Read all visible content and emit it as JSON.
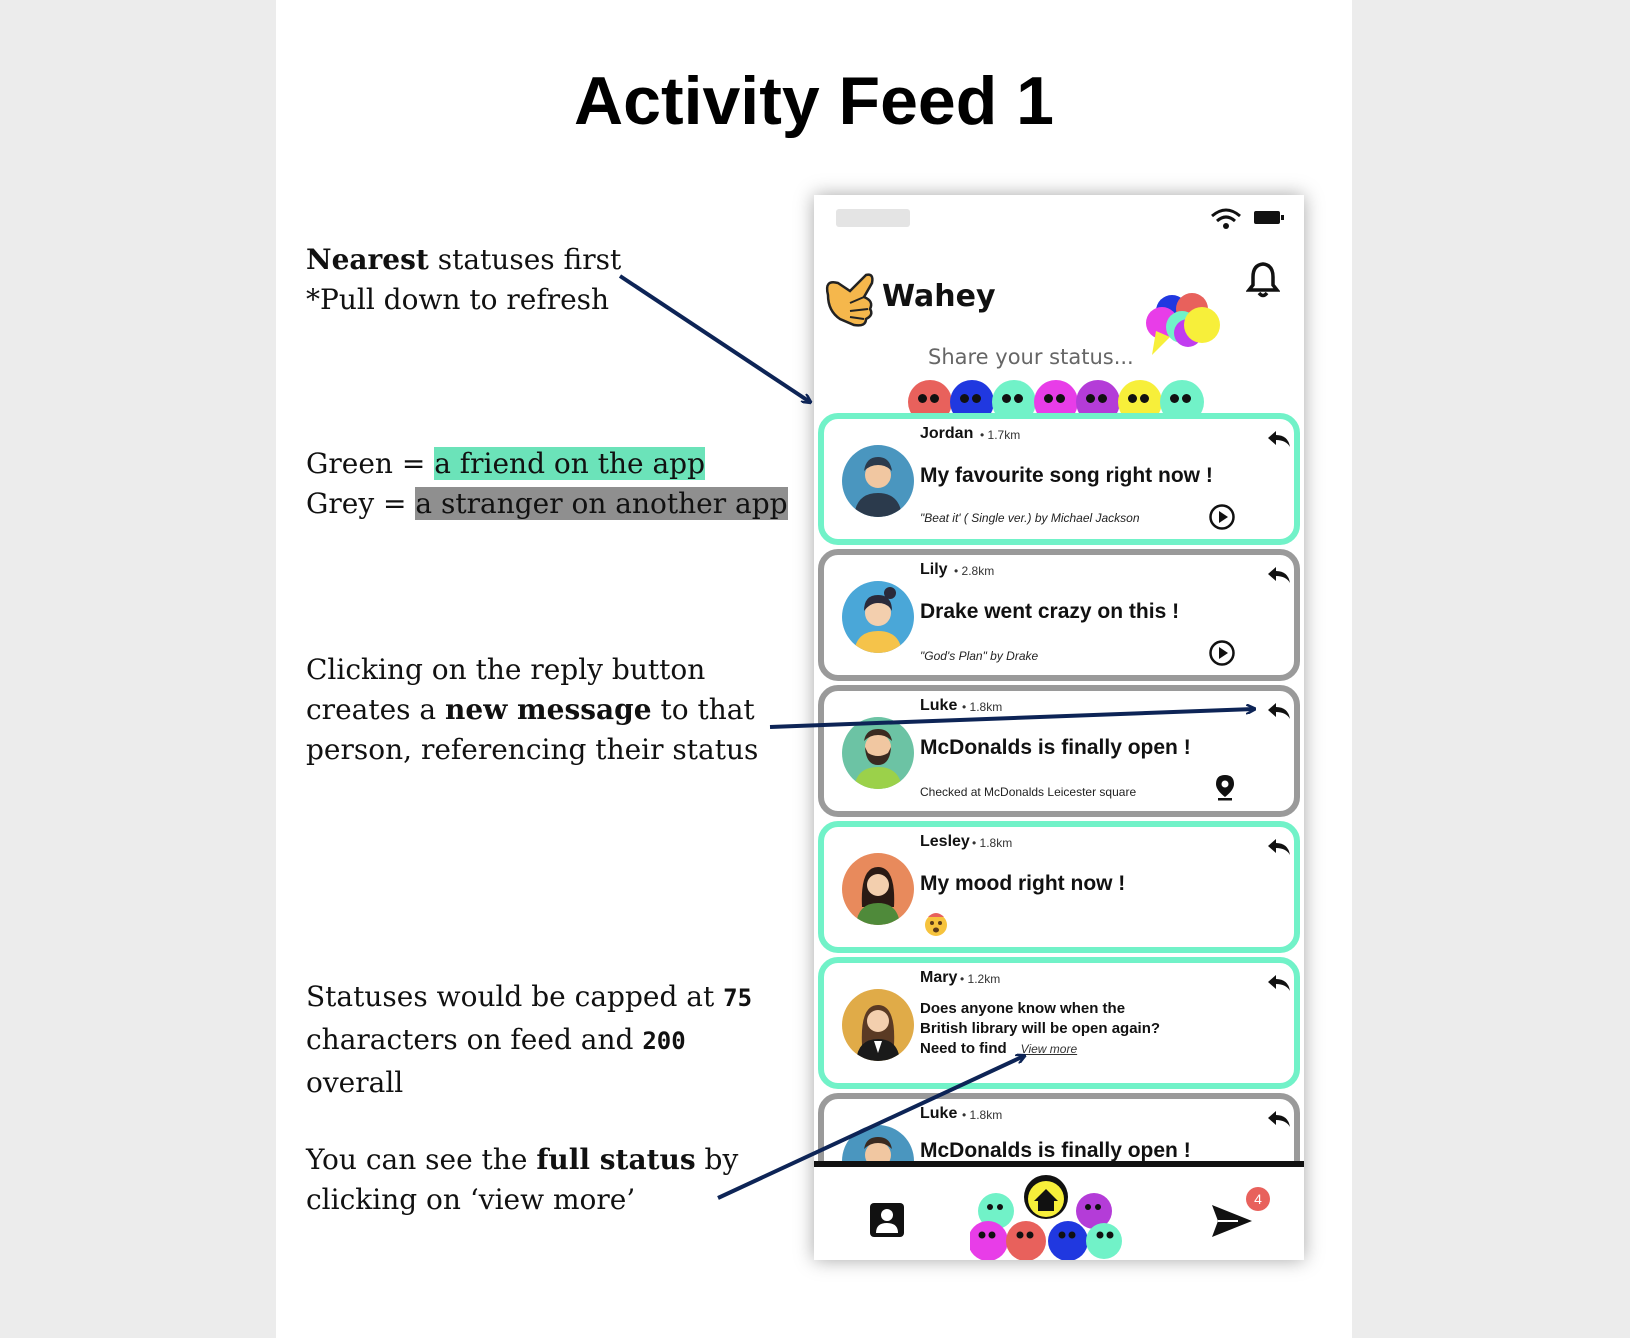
{
  "slide": {
    "title": "Activity Feed 1"
  },
  "notes": {
    "nearest_bold": "Nearest",
    "nearest_rest": " statuses first",
    "pull": "*Pull down to refresh",
    "green_label": "Green = ",
    "green_text": "a friend on the app",
    "grey_label": "Grey = ",
    "grey_text": "a stranger on another app",
    "reply_line1": "Clicking on the reply button",
    "reply_line2_a": "creates a ",
    "reply_line2_bold": "new message",
    "reply_line2_b": " to that",
    "reply_line3": "person, referencing their status",
    "cap_line1_a": "Statuses would be capped at ",
    "cap_feed_num": "75",
    "cap_line2_a": "characters on feed and ",
    "cap_overall_num": "200",
    "cap_line3": "overall",
    "full_a": "You can see the ",
    "full_bold": "full status",
    "full_b": " by",
    "full_line2": "clicking on ‘view more’"
  },
  "app": {
    "name": "Wahey",
    "share_prompt": "Share your status...",
    "notification_badge": "4"
  },
  "feed": [
    {
      "name": "Jordan",
      "distance": "• 1.7km",
      "type": "friend",
      "title": "My favourite song right now !",
      "sub": "\"Beat it' ( Single ver.) by Michael Jackson",
      "action": "play-icon"
    },
    {
      "name": "Lily",
      "distance": "• 2.8km",
      "type": "stranger",
      "title": "Drake went crazy on this !",
      "sub": "\"God's Plan\" by Drake",
      "action": "play-icon"
    },
    {
      "name": "Luke",
      "distance": "• 1.8km",
      "type": "stranger",
      "title": "McDonalds is finally open !",
      "sub": "Checked at McDonalds Leicester square",
      "action": "location-pin-icon"
    },
    {
      "name": "Lesley",
      "distance": "• 1.8km",
      "type": "friend",
      "title": "My mood right now !",
      "sub": "",
      "action": "emoji-icon"
    },
    {
      "name": "Mary",
      "distance": "• 1.2km",
      "type": "friend",
      "text_line1": "Does anyone know when the",
      "text_line2": "British library will be open again?",
      "text_line3": "Need to find",
      "view_more": "View more"
    },
    {
      "name": "Luke",
      "distance": "• 1.8km",
      "type": "stranger",
      "title": "McDonalds is finally open !"
    }
  ],
  "colors": {
    "friend": "#71f2c8",
    "stranger": "#9a9a9a",
    "arrow": "#0d2456"
  }
}
